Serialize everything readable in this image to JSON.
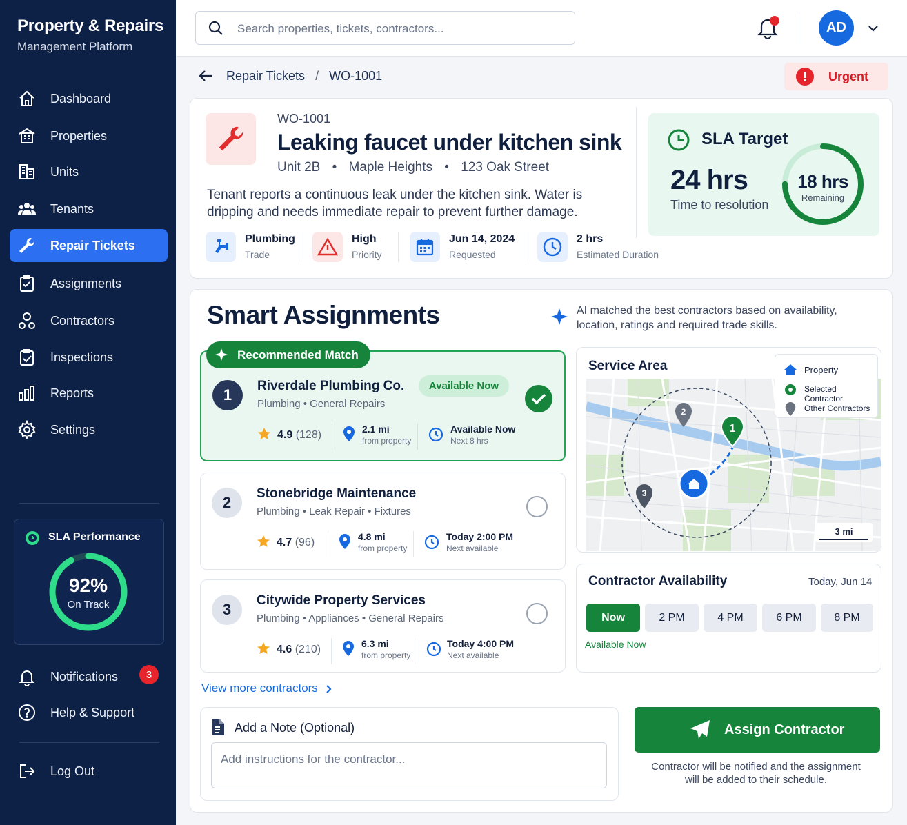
{
  "brand": {
    "title": "Property & Repairs",
    "subtitle": "Management Platform"
  },
  "nav": [
    {
      "label": "Dashboard",
      "icon": "home-icon"
    },
    {
      "label": "Properties",
      "icon": "building-icon"
    },
    {
      "label": "Units",
      "icon": "units-icon"
    },
    {
      "label": "Tenants",
      "icon": "users-icon"
    },
    {
      "label": "Repair Tickets",
      "icon": "wrench-icon",
      "active": true
    },
    {
      "label": "Assignments",
      "icon": "clipboard-icon"
    },
    {
      "label": "Contractors",
      "icon": "contractors-icon"
    },
    {
      "label": "Inspections",
      "icon": "clipboard-check-icon"
    },
    {
      "label": "Reports",
      "icon": "bar-chart-icon"
    },
    {
      "label": "Settings",
      "icon": "gear-icon"
    }
  ],
  "sla_performance": {
    "title": "SLA Performance",
    "percent": "92%",
    "status": "On Track",
    "fraction": 0.92
  },
  "bottom_nav": {
    "notifications": "Notifications",
    "notifications_count": "3",
    "help": "Help & Support",
    "logout": "Log Out"
  },
  "search": {
    "placeholder": "Search properties, tickets, contractors..."
  },
  "user": {
    "initials": "AD"
  },
  "breadcrumb": {
    "parent": "Repair Tickets",
    "sep": "/",
    "current": "WO-1001"
  },
  "priority_badge": "Urgent",
  "ticket": {
    "id": "WO-1001",
    "title": "Leaking faucet under kitchen sink",
    "unit": "Unit 2B",
    "property": "Maple Heights",
    "address": "123 Oak Street",
    "bullet": "•",
    "description": "Tenant reports a continuous leak under the kitchen sink. Water is dripping and needs immediate repair to prevent further damage.",
    "metrics": [
      {
        "value": "Plumbing",
        "label": "Trade"
      },
      {
        "value": "High",
        "label": "Priority"
      },
      {
        "value": "Jun 14, 2024",
        "label": "Requested"
      },
      {
        "value": "2 hrs",
        "label": "Estimated Duration"
      }
    ]
  },
  "sla_target": {
    "title": "SLA Target",
    "hours": "24 hrs",
    "label": "Time to resolution",
    "remaining": "18 hrs",
    "remaining_label": "Remaining",
    "remaining_fraction": 0.75
  },
  "smart": {
    "title": "Smart Assignments",
    "ai_note": "AI matched the best contractors based on availability, location, ratings and required trade skills.",
    "recommended_label": "Recommended Match",
    "view_more": "View more contractors"
  },
  "contractors": [
    {
      "rank": "1",
      "name": "Riverdale Plumbing Co.",
      "tags": "Plumbing  •  General Repairs",
      "rating": "4.9",
      "reviews": "(128)",
      "distance": "2.1 mi",
      "distance_label": "from property",
      "availability": "Available Now",
      "availability_sub": "Next 8 hrs",
      "status_badge": "Available Now"
    },
    {
      "rank": "2",
      "name": "Stonebridge Maintenance",
      "tags": "Plumbing  •  Leak Repair  •  Fixtures",
      "rating": "4.7",
      "reviews": "(96)",
      "distance": "4.8 mi",
      "distance_label": "from property",
      "availability": "Today 2:00 PM",
      "availability_sub": "Next available"
    },
    {
      "rank": "3",
      "name": "Citywide Property Services",
      "tags": "Plumbing  •  Appliances  •  General Repairs",
      "rating": "4.6",
      "reviews": "(210)",
      "distance": "6.3 mi",
      "distance_label": "from property",
      "availability": "Today 4:00 PM",
      "availability_sub": "Next available"
    }
  ],
  "service_area": {
    "title": "Service Area",
    "legend": [
      "Property",
      "Selected Contractor",
      "Other Contractors"
    ],
    "scale": "3 mi",
    "pins": [
      "1",
      "2",
      "3"
    ]
  },
  "availability": {
    "title": "Contractor Availability",
    "date": "Today, Jun 14",
    "slots": [
      "Now",
      "2 PM",
      "4 PM",
      "6 PM",
      "8 PM"
    ],
    "selected_note": "Available Now"
  },
  "note": {
    "title": "Add a Note (Optional)",
    "placeholder": "Add instructions for the contractor..."
  },
  "assign": {
    "button": "Assign Contractor",
    "info": "Contractor will be notified and the assignment will be added to their schedule."
  },
  "colors": {
    "sidebar": "#0d2147",
    "accent_blue": "#2c6ff0",
    "green": "#16853b",
    "urgent_red": "#e5242b",
    "sla_green_bg": "#e8f7ef"
  }
}
